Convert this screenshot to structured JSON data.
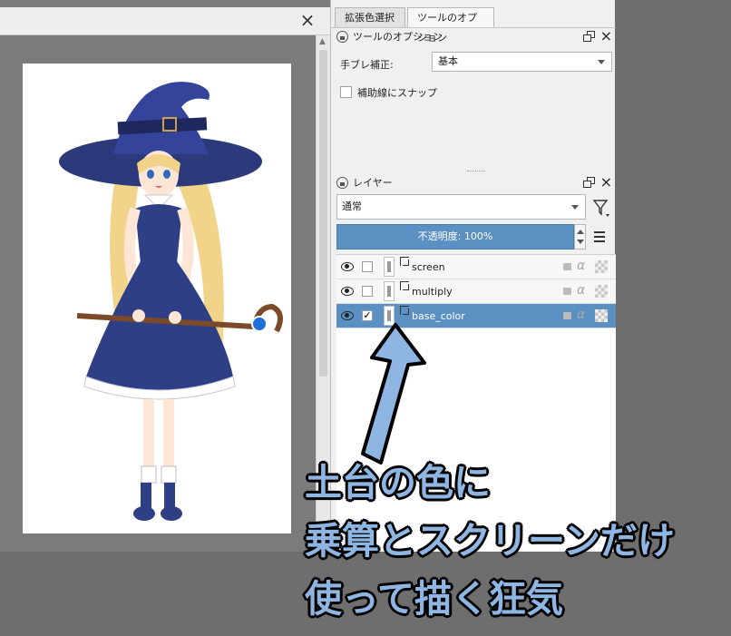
{
  "tabs": [
    {
      "label": "拡張色選択",
      "active": false
    },
    {
      "label": "ツールのオプション",
      "active": true
    }
  ],
  "tool_options": {
    "title": "ツールのオプション",
    "stabilizer_label": "手ブレ補正:",
    "stabilizer_value": "基本",
    "snap_label": "補助線にスナップ",
    "snap_checked": false
  },
  "layers": {
    "title": "レイヤー",
    "blend_mode": "通常",
    "opacity_text": "不透明度: 100%",
    "items": [
      {
        "name": "screen",
        "visible": true,
        "checked": false,
        "selected": false
      },
      {
        "name": "multiply",
        "visible": true,
        "checked": false,
        "selected": false
      },
      {
        "name": "base_color",
        "visible": true,
        "checked": true,
        "selected": true
      }
    ]
  },
  "caption": {
    "line1": "土台の色に",
    "line2": "乗算とスクリーンだけ",
    "line3": "使って描く狂気"
  },
  "colors": {
    "accent": "#5b90c2",
    "caption_fill": "#8fb5e2",
    "dress": "#2f3f86",
    "hair": "#f1d48a"
  }
}
